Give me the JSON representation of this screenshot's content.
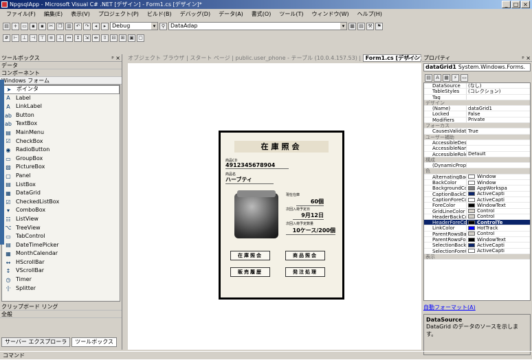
{
  "window": {
    "title": "NpgsqlApp - Microsoft Visual C# .NET [デザイン] - Form1.cs [デザイン]*",
    "controls": [
      "_",
      "□",
      "×"
    ]
  },
  "menu": [
    "ファイル(F)",
    "編集(E)",
    "表示(V)",
    "プロジェクト(P)",
    "ビルド(B)",
    "デバッグ(D)",
    "データ(A)",
    "書式(O)",
    "ツール(T)",
    "ウィンドウ(W)",
    "ヘルプ(H)"
  ],
  "toolbar": {
    "config": "Debug",
    "project": "DataAdap"
  },
  "toolbox": {
    "header": "ツールボックス",
    "pin": "ᵖ ×",
    "categories": [
      "データ",
      "コンポーネント",
      "Windows フォーム"
    ],
    "items": [
      "ポインタ",
      "Label",
      "LinkLabel",
      "Button",
      "TextBox",
      "MainMenu",
      "CheckBox",
      "RadioButton",
      "GroupBox",
      "PictureBox",
      "Panel",
      "ListBox",
      "DataGrid",
      "CheckedListBox",
      "ComboBox",
      "ListView",
      "TreeView",
      "TabControl",
      "DateTimePicker",
      "MonthCalendar",
      "HScrollBar",
      "VScrollBar",
      "Timer",
      "Splitter"
    ],
    "icons": [
      "➤",
      "A",
      "A",
      "ab",
      "ab",
      "▤",
      "☑",
      "◉",
      "▭",
      "▨",
      "▢",
      "▤",
      "▦",
      "☑",
      "▾",
      "☷",
      "⌥",
      "▭",
      "▤",
      "▦",
      "↔",
      "↕",
      "◷",
      "·|·"
    ],
    "bottom_cats": [
      "クリップボード リング",
      "全般"
    ],
    "tabs": [
      "サーバー エクスプローラ",
      "ツールボックス"
    ]
  },
  "doc": {
    "tabs": "オブジェクト ブラウザ | スタート ページ | public.user_phone - テーブル (10.0.4.157.53) |",
    "active_tab": "Form1.cs [デザイン]*",
    "nav": "◂ ▸ ×"
  },
  "form": {
    "title": "在庫照会",
    "code_label": "商品CD",
    "code_value": "4912345678904",
    "name_label": "商品名",
    "name_value": "ハーブティ",
    "stock_label": "現在在庫",
    "stock_value": "60個",
    "next_date_label": "次回入荷予定日",
    "next_date_value": "9月12日",
    "next_qty_label": "次回入荷予定数量",
    "next_qty_value": "10ケース/200個",
    "buttons": [
      "在庫照会",
      "商品照会",
      "販売履歴",
      "発注処理"
    ]
  },
  "props": {
    "header": "プロパティ",
    "selector_name": "dataGrid1",
    "selector_type": "System.Windows.Forms.",
    "rows": [
      {
        "n": "DataSource",
        "v": "(なし)"
      },
      {
        "n": "TableStyles",
        "v": "(コレクション)"
      },
      {
        "n": "Tag",
        "v": ""
      },
      {
        "n": "デザイン",
        "cat": true
      },
      {
        "n": "(Name)",
        "v": "dataGrid1"
      },
      {
        "n": "Locked",
        "v": "False"
      },
      {
        "n": "Modifiers",
        "v": "Private"
      },
      {
        "n": "フォーカス",
        "cat": true
      },
      {
        "n": "CausesValidatio",
        "v": "True"
      },
      {
        "n": "ユーザー補助",
        "cat": true
      },
      {
        "n": "AccessibleDesc",
        "v": ""
      },
      {
        "n": "AccessibleName",
        "v": ""
      },
      {
        "n": "AccessibleRole",
        "v": "Default"
      },
      {
        "n": "構成",
        "cat": true
      },
      {
        "n": "(DynamicProper",
        "v": ""
      },
      {
        "n": "色",
        "cat": true
      },
      {
        "n": "AlternatingBack",
        "v": "Window",
        "c": "#ffffff"
      },
      {
        "n": "BackColor",
        "v": "Window",
        "c": "#ffffff"
      },
      {
        "n": "BackgroundColo",
        "v": "AppWorkspa",
        "c": "#808080"
      },
      {
        "n": "CaptionBackCol",
        "v": "ActiveCapti",
        "c": "#0a246a"
      },
      {
        "n": "CaptionForeColc",
        "v": "ActiveCapti",
        "c": "#ffffff"
      },
      {
        "n": "ForeColor",
        "v": "WindowText",
        "c": "#000000"
      },
      {
        "n": "GridLineColor",
        "v": "Control",
        "c": "#d4d0c8"
      },
      {
        "n": "HeaderBackColc",
        "v": "Control",
        "c": "#d4d0c8"
      },
      {
        "n": "HeaderForeColo",
        "v": "ControlTe",
        "c": "#000000",
        "hl": true
      },
      {
        "n": "LinkColor",
        "v": "HotTrack",
        "c": "#0000ff"
      },
      {
        "n": "ParentRowsBack",
        "v": "Control",
        "c": "#d4d0c8"
      },
      {
        "n": "ParentRowsFore",
        "v": "WindowText",
        "c": "#000000"
      },
      {
        "n": "SelectionBackC",
        "v": "ActiveCapti",
        "c": "#0a246a"
      },
      {
        "n": "SelectionForeCo",
        "v": "ActiveCapti",
        "c": "#ffffff"
      },
      {
        "n": "表示",
        "cat": true
      }
    ],
    "autoformat": "自動フォーマット(A)",
    "desc_title": "DataSource",
    "desc_text": "DataGrid のデータのソースを示します。"
  },
  "status": "コマンド"
}
